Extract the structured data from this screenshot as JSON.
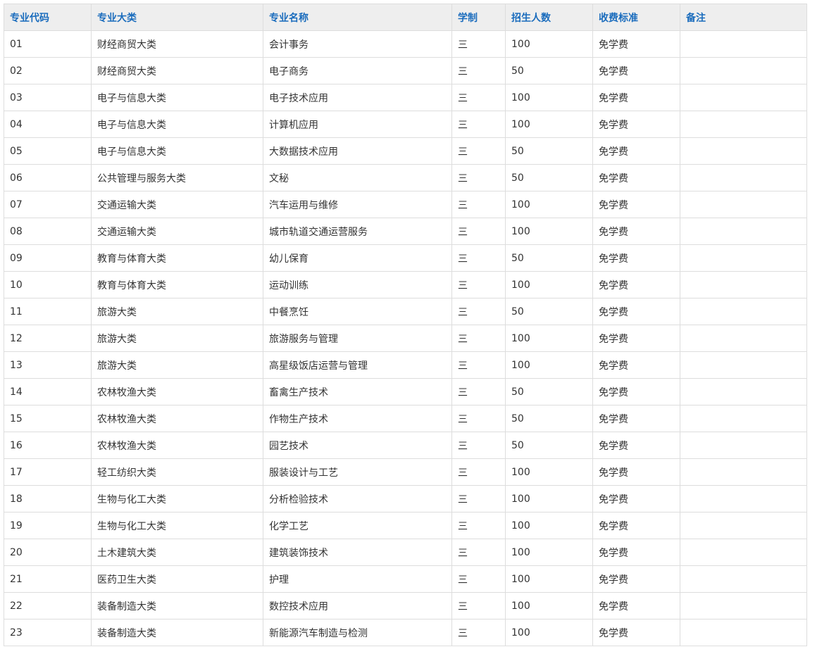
{
  "table": {
    "headers": [
      "专业代码",
      "专业大类",
      "专业名称",
      "学制",
      "招生人数",
      "收费标准",
      "备注"
    ],
    "rows": [
      [
        "01",
        "财经商贸大类",
        "会计事务",
        "三",
        "100",
        "免学费",
        ""
      ],
      [
        "02",
        "财经商贸大类",
        "电子商务",
        "三",
        "50",
        "免学费",
        ""
      ],
      [
        "03",
        "电子与信息大类",
        "电子技术应用",
        "三",
        "100",
        "免学费",
        ""
      ],
      [
        "04",
        "电子与信息大类",
        "计算机应用",
        "三",
        "100",
        "免学费",
        ""
      ],
      [
        "05",
        "电子与信息大类",
        "大数据技术应用",
        "三",
        "50",
        "免学费",
        ""
      ],
      [
        "06",
        "公共管理与服务大类",
        "文秘",
        "三",
        "50",
        "免学费",
        ""
      ],
      [
        "07",
        "交通运输大类",
        "汽车运用与维修",
        "三",
        "100",
        "免学费",
        ""
      ],
      [
        "08",
        "交通运输大类",
        "城市轨道交通运营服务",
        "三",
        "100",
        "免学费",
        ""
      ],
      [
        "09",
        "教育与体育大类",
        "幼儿保育",
        "三",
        "50",
        "免学费",
        ""
      ],
      [
        "10",
        "教育与体育大类",
        "运动训练",
        "三",
        "100",
        "免学费",
        ""
      ],
      [
        "11",
        "旅游大类",
        "中餐烹饪",
        "三",
        "50",
        "免学费",
        ""
      ],
      [
        "12",
        "旅游大类",
        "旅游服务与管理",
        "三",
        "100",
        "免学费",
        ""
      ],
      [
        "13",
        "旅游大类",
        "高星级饭店运营与管理",
        "三",
        "100",
        "免学费",
        ""
      ],
      [
        "14",
        "农林牧渔大类",
        "畜禽生产技术",
        "三",
        "50",
        "免学费",
        ""
      ],
      [
        "15",
        "农林牧渔大类",
        "作物生产技术",
        "三",
        "50",
        "免学费",
        ""
      ],
      [
        "16",
        "农林牧渔大类",
        "园艺技术",
        "三",
        "50",
        "免学费",
        ""
      ],
      [
        "17",
        "轻工纺织大类",
        "服装设计与工艺",
        "三",
        "100",
        "免学费",
        ""
      ],
      [
        "18",
        "生物与化工大类",
        "分析检验技术",
        "三",
        "100",
        "免学费",
        ""
      ],
      [
        "19",
        "生物与化工大类",
        "化学工艺",
        "三",
        "100",
        "免学费",
        ""
      ],
      [
        "20",
        "土木建筑大类",
        "建筑装饰技术",
        "三",
        "100",
        "免学费",
        ""
      ],
      [
        "21",
        "医药卫生大类",
        "护理",
        "三",
        "100",
        "免学费",
        ""
      ],
      [
        "22",
        "装备制造大类",
        "数控技术应用",
        "三",
        "100",
        "免学费",
        ""
      ],
      [
        "23",
        "装备制造大类",
        "新能源汽车制造与检测",
        "三",
        "100",
        "免学费",
        ""
      ]
    ]
  },
  "colors": {
    "header_text": "#1a6cbd",
    "header_bg": "#eeeeee",
    "border": "#dddddd",
    "cell_text": "#333333"
  }
}
